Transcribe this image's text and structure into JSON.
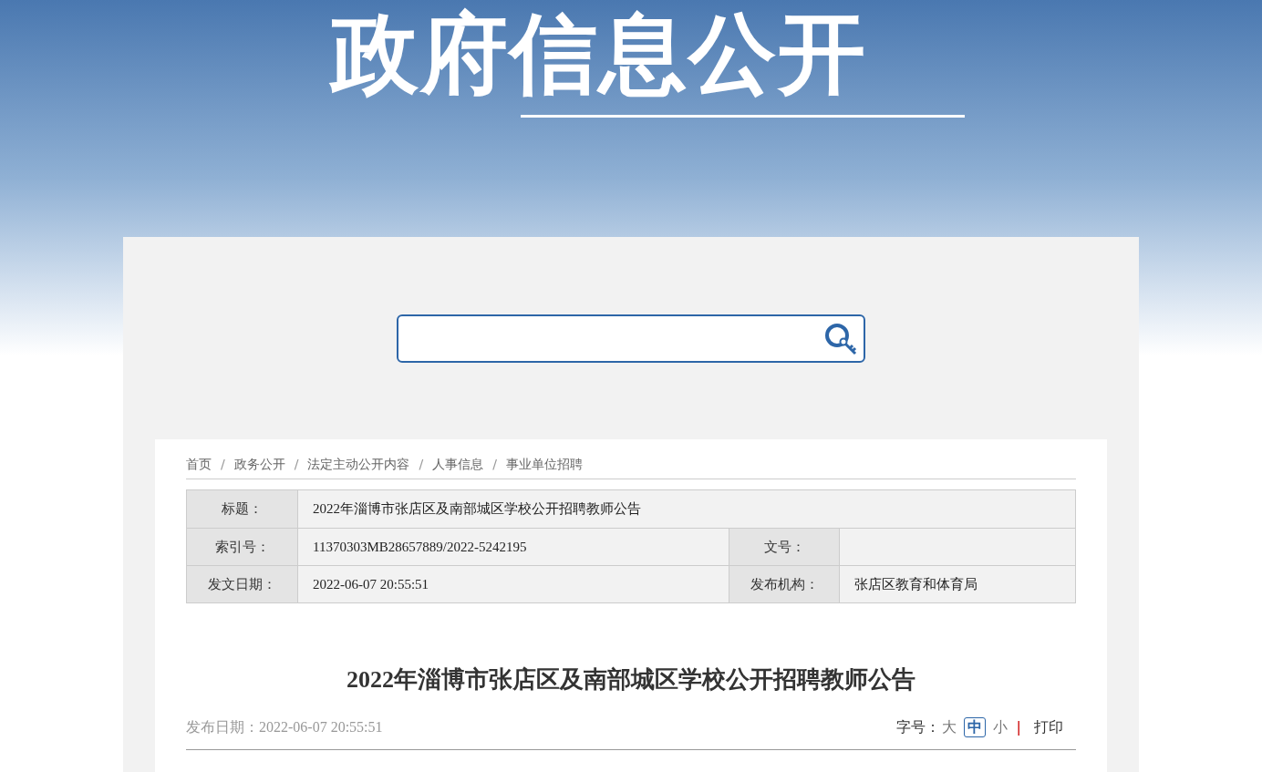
{
  "banner": {
    "title": "政府信息公开"
  },
  "breadcrumb": [
    {
      "label": "首页"
    },
    {
      "separator": "/",
      "label": "政务公开"
    },
    {
      "separator": "/",
      "label": "法定主动公开内容"
    },
    {
      "separator": "/",
      "label": "人事信息"
    },
    {
      "separator": "/",
      "label": "事业单位招聘"
    }
  ],
  "info_table": {
    "rows": [
      {
        "cells": [
          {
            "label": "标题：",
            "value": "2022年淄博市张店区及南部城区学校公开招聘教师公告"
          }
        ]
      },
      {
        "cells": [
          {
            "label": "索引号：",
            "value": "11370303MB28657889/2022-5242195"
          },
          {
            "label": "文号："
          }
        ]
      },
      {
        "cells": [
          {
            "label": "发文日期：",
            "value": "2022-06-07 20:55:51"
          },
          {
            "label": "发布机构：",
            "value": "张店区教育和体育局"
          }
        ]
      }
    ]
  },
  "article": {
    "title": "2022年淄博市张店区及南部城区学校公开招聘教师公告",
    "date": "发布日期：2022-06-07 20:55:51",
    "font_size": {
      "label": "字号：",
      "options": [
        {
          "label": "大",
          "selected": false
        },
        {
          "label": "中",
          "selected": true
        },
        {
          "label": "小",
          "selected": false
        }
      ]
    },
    "separator": "|",
    "print": "打印"
  }
}
